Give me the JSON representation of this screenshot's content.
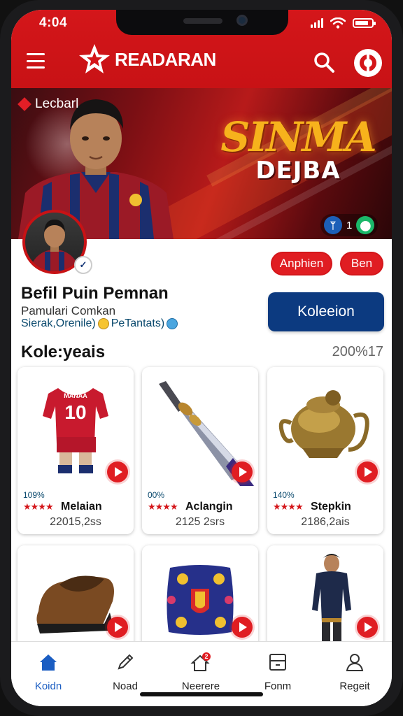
{
  "status_bar": {
    "time": "4:04",
    "battery_level": 0.8
  },
  "header": {
    "app_name": "READARAN",
    "brand_color": "#d4161a"
  },
  "banner": {
    "label": "Lecbarl",
    "title_line1": "SINMA",
    "title_line2": "DEJBA",
    "stat_count": "1"
  },
  "profile": {
    "name": "Befil Puin Pemnan",
    "subtitle": "Pamulari Comkan",
    "tag1": "Sierak,Orenile)",
    "tag2": "PeTantats)",
    "pill1": "Anphien",
    "pill2": "Ben",
    "primary_button": "Koleeion"
  },
  "collection": {
    "title": "Kole:yeais",
    "count": "200%17",
    "items": [
      {
        "pct": "109%",
        "name": "Melaian",
        "meta": "22015,2ss",
        "icon": "jersey-image"
      },
      {
        "pct": "00%",
        "name": "Aclangin",
        "meta": "2125 2srs",
        "icon": "dagger-image"
      },
      {
        "pct": "140%",
        "name": "Stepkin",
        "meta": "2186,2ais",
        "icon": "teapot-image"
      },
      {
        "icon": "shoe-image"
      },
      {
        "icon": "pillow-image"
      },
      {
        "icon": "player-figure-image"
      }
    ],
    "stars": "★★★★",
    "jersey_number": "10",
    "jersey_name": "MANAA"
  },
  "bottom_nav": [
    {
      "label": "Koidn",
      "icon": "home-icon",
      "active": true
    },
    {
      "label": "Noad",
      "icon": "pen-icon",
      "active": false
    },
    {
      "label": "Neerere",
      "icon": "house-alert-icon",
      "badge": "2",
      "active": false
    },
    {
      "label": "Fonm",
      "icon": "card-icon",
      "active": false
    },
    {
      "label": "Regeit",
      "icon": "user-icon",
      "active": false
    }
  ],
  "colors": {
    "accent_red": "#d4161a",
    "primary_blue": "#0c3a80",
    "active_nav": "#1a5dc2"
  }
}
